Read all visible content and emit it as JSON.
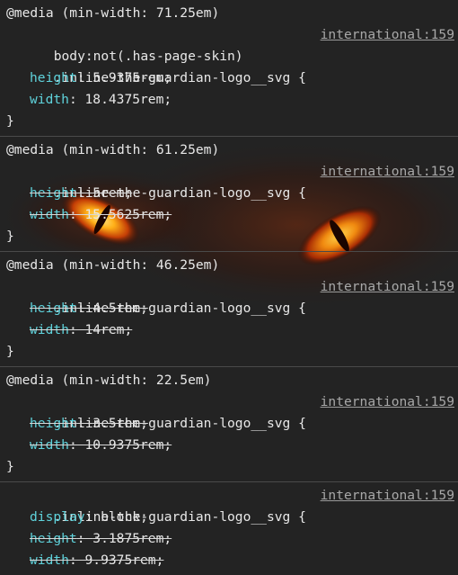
{
  "rules": [
    {
      "media": "@media (min-width: 71.25em)",
      "extra_selector": "body:not(.has-page-skin)",
      "selector": ".inline-the-guardian-logo__svg {",
      "source": "international:159",
      "decls": [
        {
          "prop": "height",
          "value": "5.9375rem;",
          "overridden": false
        },
        {
          "prop": "width",
          "value": "18.4375rem;",
          "overridden": false
        }
      ],
      "close": "}"
    },
    {
      "media": "@media (min-width: 61.25em)",
      "selector": ".inline-the-guardian-logo__svg {",
      "source": "international:159",
      "decls": [
        {
          "prop": "height",
          "value": "5rem;",
          "overridden": true
        },
        {
          "prop": "width",
          "value": "15.5625rem;",
          "overridden": true
        }
      ],
      "close": "}"
    },
    {
      "media": "@media (min-width: 46.25em)",
      "selector": ".inline-the-guardian-logo__svg {",
      "source": "international:159",
      "decls": [
        {
          "prop": "height",
          "value": "4.5rem;",
          "overridden": true
        },
        {
          "prop": "width",
          "value": "14rem;",
          "overridden": true
        }
      ],
      "close": "}"
    },
    {
      "media": "@media (min-width: 22.5em)",
      "selector": ".inline-the-guardian-logo__svg {",
      "source": "international:159",
      "decls": [
        {
          "prop": "height",
          "value": "3.5rem;",
          "overridden": true
        },
        {
          "prop": "width",
          "value": "10.9375rem;",
          "overridden": true
        }
      ],
      "close": "}"
    },
    {
      "selector": ".inline-the-guardian-logo__svg {",
      "source": "international:159",
      "decls": [
        {
          "prop": "display",
          "value": "block;",
          "overridden": false
        },
        {
          "prop": "height",
          "value": "3.1875rem;",
          "overridden": true
        },
        {
          "prop": "width",
          "value": "9.9375rem;",
          "overridden": true
        }
      ]
    }
  ],
  "colors": {
    "background": "#232323",
    "property": "#5fd3dc",
    "text": "#e8e8e8",
    "source_link": "#a8a8a8",
    "divider": "#4a4a4a"
  },
  "icons": [
    "glowing-eyes-background"
  ]
}
